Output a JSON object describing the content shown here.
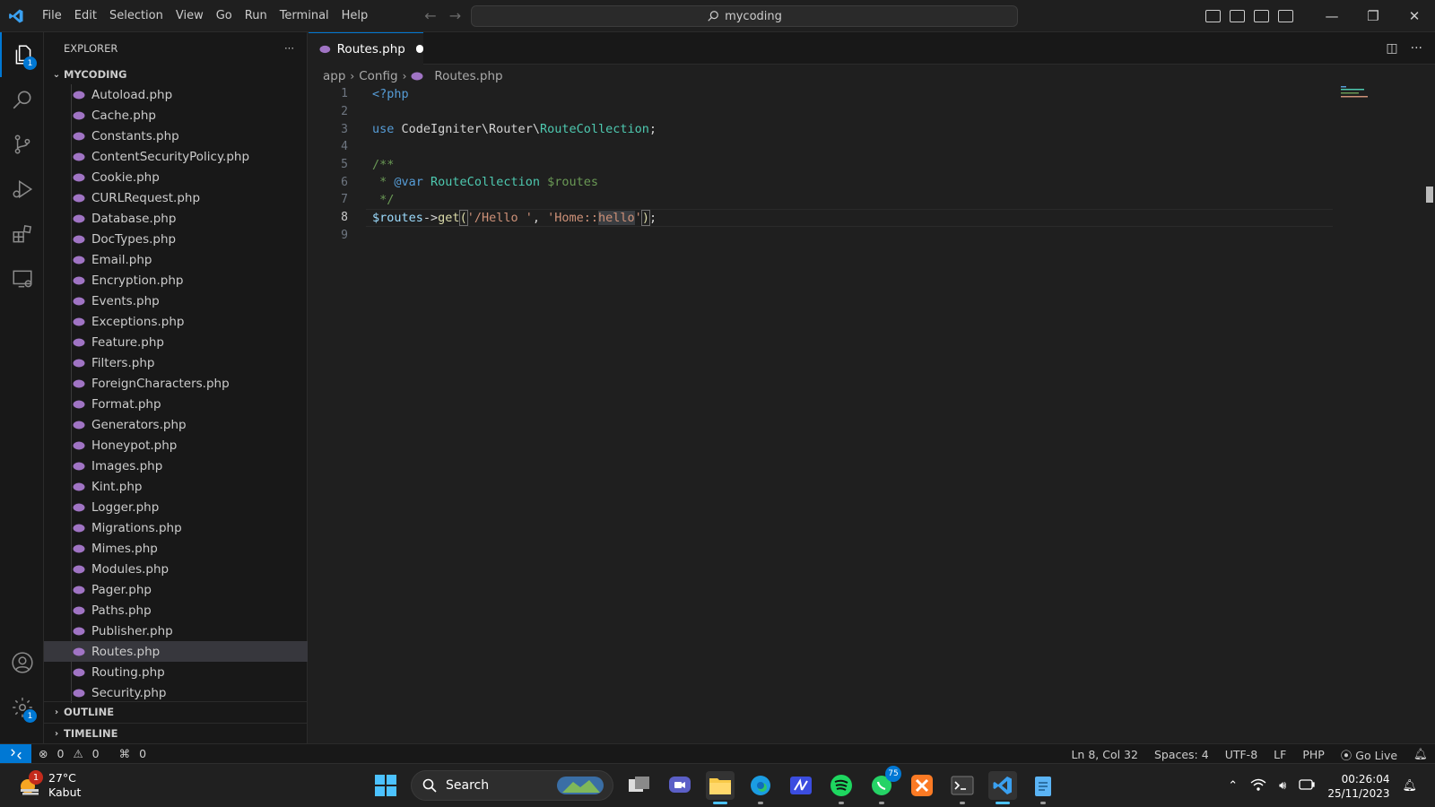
{
  "titlebar": {
    "menu": [
      "File",
      "Edit",
      "Selection",
      "View",
      "Go",
      "Run",
      "Terminal",
      "Help"
    ],
    "search": "mycoding"
  },
  "activity_bar": {
    "explorer_badge": "1",
    "settings_badge": "1"
  },
  "sidebar": {
    "title": "EXPLORER",
    "more": "···",
    "folder": "MYCODING",
    "files": [
      "Autoload.php",
      "Cache.php",
      "Constants.php",
      "ContentSecurityPolicy.php",
      "Cookie.php",
      "CURLRequest.php",
      "Database.php",
      "DocTypes.php",
      "Email.php",
      "Encryption.php",
      "Events.php",
      "Exceptions.php",
      "Feature.php",
      "Filters.php",
      "ForeignCharacters.php",
      "Format.php",
      "Generators.php",
      "Honeypot.php",
      "Images.php",
      "Kint.php",
      "Logger.php",
      "Migrations.php",
      "Mimes.php",
      "Modules.php",
      "Pager.php",
      "Paths.php",
      "Publisher.php",
      "Routes.php",
      "Routing.php",
      "Security.php"
    ],
    "selected_file": "Routes.php",
    "outline": "OUTLINE",
    "timeline": "TIMELINE"
  },
  "editor": {
    "tab": "Routes.php",
    "breadcrumb": [
      "app",
      "Config",
      "Routes.php"
    ],
    "line_numbers": [
      "1",
      "2",
      "3",
      "4",
      "5",
      "6",
      "7",
      "8",
      "9"
    ],
    "current_line": 8,
    "code": {
      "l1": "<?php",
      "l3_use": "use",
      "l3_ns": " CodeIgniter\\Router\\",
      "l3_cls": "RouteCollection",
      "l3_end": ";",
      "l5": "/**",
      "l6_star": " * ",
      "l6_tag": "@var",
      "l6_sp": " ",
      "l6_cls": "RouteCollection",
      "l6_var": " $routes",
      "l7": " */",
      "l8_var": "$routes",
      "l8_arrow": "->",
      "l8_fn": "get",
      "l8_open": "(",
      "l8_s1": "'/Hello '",
      "l8_comma": ", ",
      "l8_s2a": "'Home::",
      "l8_s2b": "hello",
      "l8_s2c": "'",
      "l8_close": ")",
      "l8_end": ";"
    }
  },
  "statusbar": {
    "errors": "0",
    "warnings": "0",
    "ports": "0",
    "position": "Ln 8, Col 32",
    "spaces": "Spaces: 4",
    "encoding": "UTF-8",
    "eol": "LF",
    "language": "PHP",
    "golive": "Go Live"
  },
  "taskbar": {
    "weather_temp": "27°C",
    "weather_desc": "Kabut",
    "weather_badge": "1",
    "search": "Search",
    "whatsapp_badge": "75",
    "time": "00:26:04",
    "date": "25/11/2023"
  },
  "colors": {
    "accent": "#0078d4",
    "php_icon": "#a074c4"
  }
}
